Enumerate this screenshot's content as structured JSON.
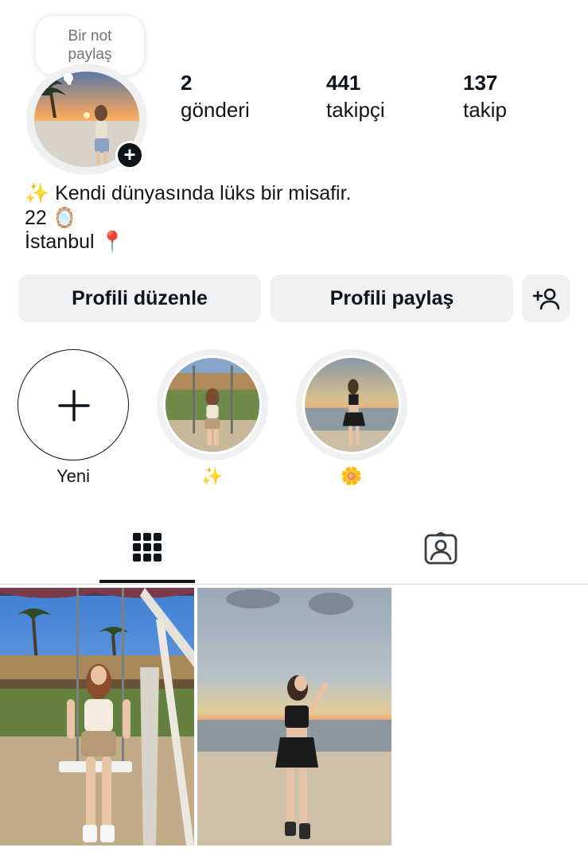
{
  "profile": {
    "note_placeholder": "Bir not paylaş",
    "stats": [
      {
        "value": "2",
        "label": "gönderi"
      },
      {
        "value": "441",
        "label": "takipçi"
      },
      {
        "value": "137",
        "label": "takip"
      }
    ],
    "bio": [
      "✨ Kendi dünyasında lüks bir misafir.",
      "22 🪞",
      "İstanbul 📍"
    ]
  },
  "actions": {
    "edit_label": "Profili düzenle",
    "share_label": "Profili paylaş",
    "add_person_icon": "add-person-icon"
  },
  "highlights": [
    {
      "caption": "Yeni",
      "kind": "new"
    },
    {
      "caption": "✨",
      "kind": "photo"
    },
    {
      "caption": "🌼",
      "kind": "photo"
    }
  ],
  "tabs": [
    {
      "icon": "grid-icon",
      "active": true
    },
    {
      "icon": "tagged-icon",
      "active": false
    }
  ],
  "colors": {
    "text": "#0f1419",
    "button_bg": "#eff1f3",
    "muted": "#737373"
  }
}
